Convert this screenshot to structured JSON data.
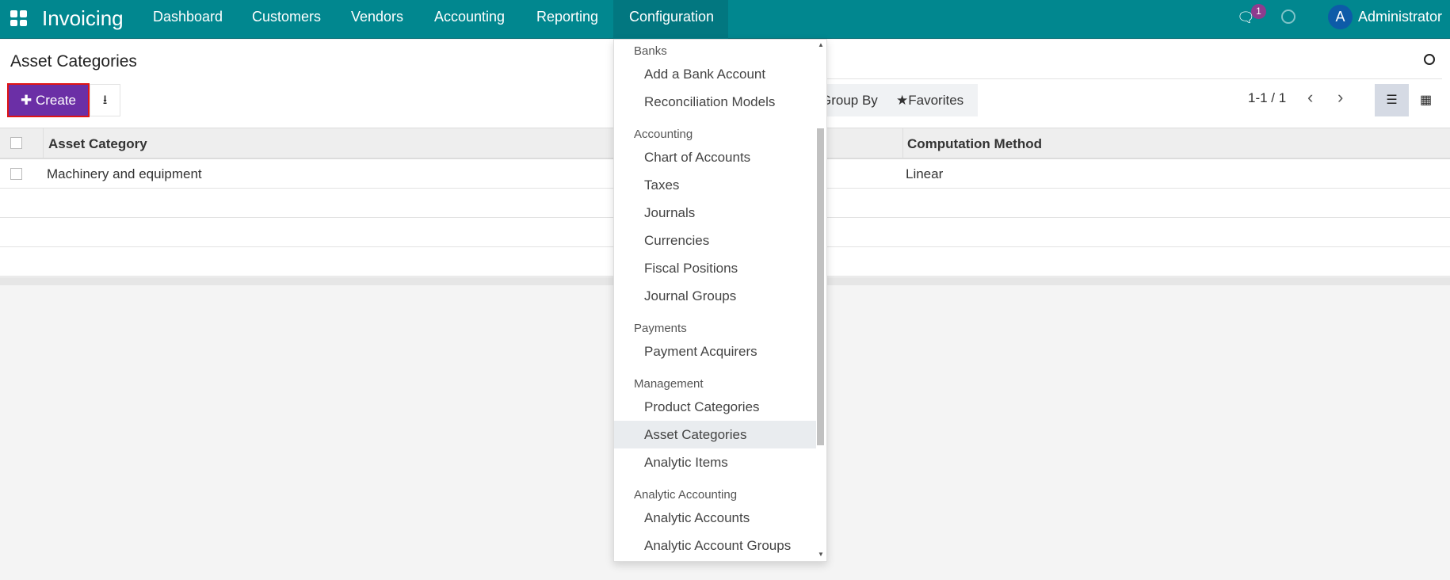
{
  "navbar": {
    "app_name": "Invoicing",
    "menus": [
      "Dashboard",
      "Customers",
      "Vendors",
      "Accounting",
      "Reporting",
      "Configuration"
    ],
    "messages_count": "1",
    "user_initial": "A",
    "user_name": "Administrator",
    "color": "#01878f"
  },
  "page": {
    "title": "Asset Categories",
    "create_label": "Create",
    "group_by_label": "Group By",
    "favorites_label": "Favorites",
    "pager": "1-1 / 1"
  },
  "table": {
    "columns": [
      "Asset Category",
      "Computation Method"
    ],
    "rows": [
      [
        "Machinery and equipment",
        "Linear"
      ]
    ]
  },
  "dropdown": {
    "sections": [
      {
        "header": "Banks",
        "items": [
          "Add a Bank Account",
          "Reconciliation Models"
        ]
      },
      {
        "header": "Accounting",
        "items": [
          "Chart of Accounts",
          "Taxes",
          "Journals",
          "Currencies",
          "Fiscal Positions",
          "Journal Groups"
        ]
      },
      {
        "header": "Payments",
        "items": [
          "Payment Acquirers"
        ]
      },
      {
        "header": "Management",
        "items": [
          "Product Categories",
          "Asset Categories",
          "Analytic Items"
        ]
      },
      {
        "header": "Analytic Accounting",
        "items": [
          "Analytic Accounts",
          "Analytic Account Groups"
        ]
      }
    ],
    "active_item": "Asset Categories"
  }
}
